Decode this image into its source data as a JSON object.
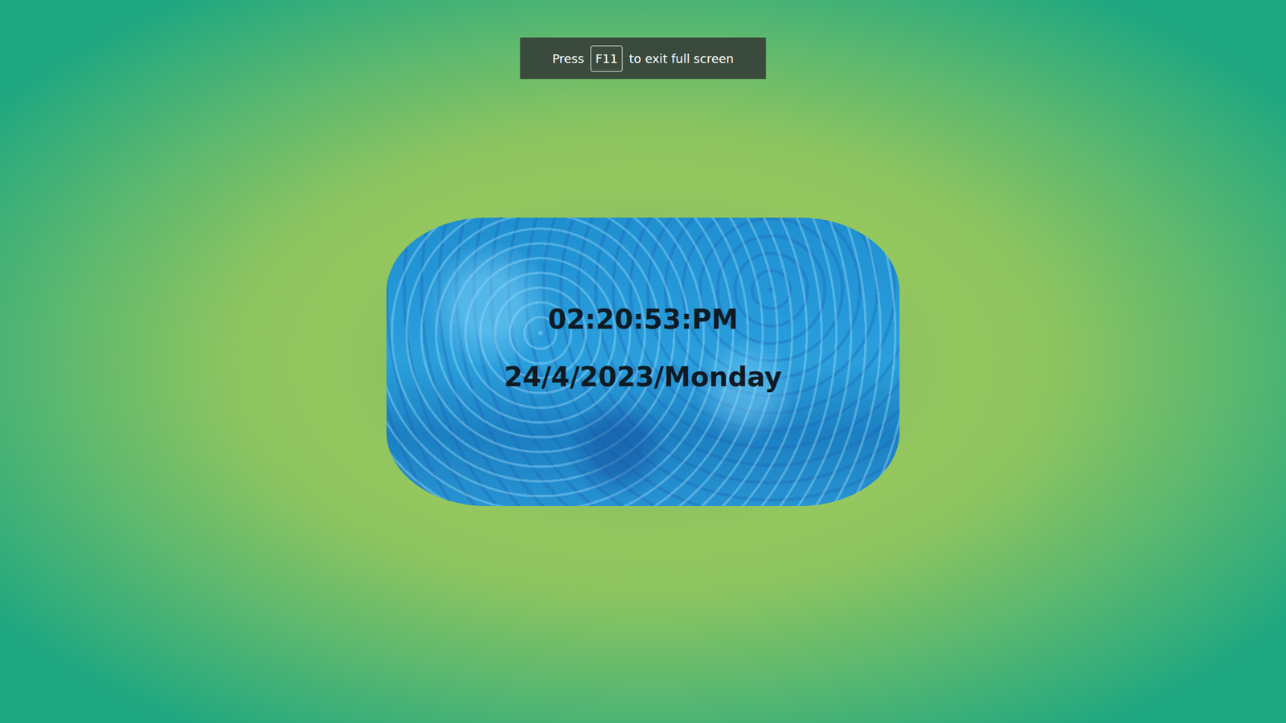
{
  "toast": {
    "before": "Press",
    "key": "F11",
    "after": "to exit full screen"
  },
  "clock": {
    "time": "02:20:53:PM",
    "date": "24/4/2023/Monday"
  }
}
